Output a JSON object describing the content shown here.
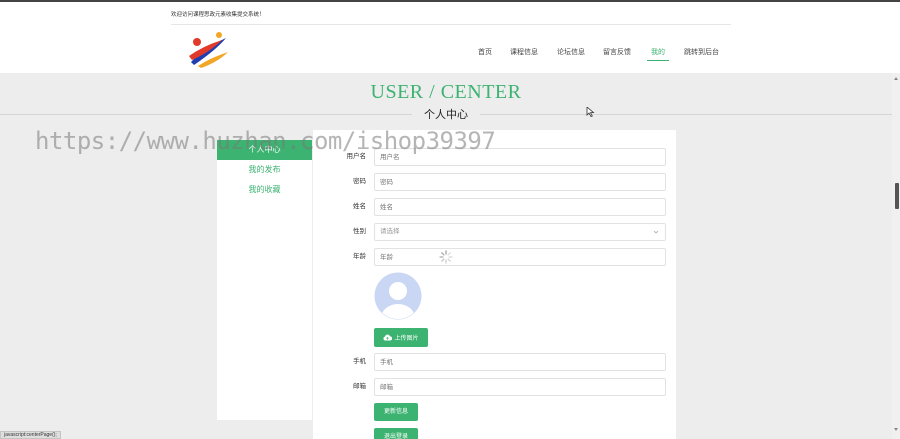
{
  "header": {
    "welcome": "欢迎访问课程思政元素收集提交系统！",
    "nav": [
      {
        "label": "首页"
      },
      {
        "label": "课程信息"
      },
      {
        "label": "论坛信息"
      },
      {
        "label": "留言反馈"
      },
      {
        "label": "我的"
      },
      {
        "label": "跳转到后台"
      }
    ],
    "active_nav": "我的"
  },
  "page": {
    "title_en": "USER / CENTER",
    "title_cn": "个人中心"
  },
  "watermark": "https://www.huzhan.com/ishop39397",
  "sidebar": {
    "items": [
      {
        "label": "个人中心"
      },
      {
        "label": "我的发布"
      },
      {
        "label": "我的收藏"
      }
    ]
  },
  "form": {
    "username": {
      "label": "用户名",
      "placeholder": "用户名"
    },
    "password": {
      "label": "密码",
      "placeholder": "密码"
    },
    "name": {
      "label": "姓名",
      "placeholder": "姓名"
    },
    "gender": {
      "label": "性别",
      "placeholder": "请选择"
    },
    "age": {
      "label": "年龄",
      "placeholder": "年龄"
    },
    "upload_label": "上传图片",
    "phone": {
      "label": "手机",
      "placeholder": "手机"
    },
    "email": {
      "label": "邮箱",
      "placeholder": "邮箱"
    },
    "update_label": "更新信息",
    "logout_label": "退出登录"
  },
  "statusbar": "javascript:centerPage();",
  "colors": {
    "accent": "#3cb371",
    "background": "#ededed"
  }
}
